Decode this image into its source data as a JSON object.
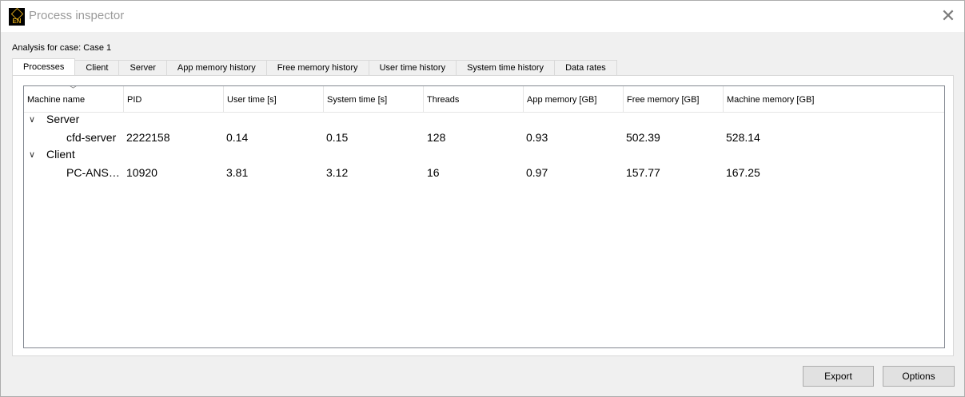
{
  "window": {
    "title": "Process inspector",
    "icon_text": "EN",
    "close_glyph": "✕"
  },
  "case_label": "Analysis for case: Case 1",
  "tabs": [
    {
      "label": "Processes",
      "active": true
    },
    {
      "label": "Client"
    },
    {
      "label": "Server"
    },
    {
      "label": "App memory history"
    },
    {
      "label": "Free memory history"
    },
    {
      "label": "User time history"
    },
    {
      "label": "System time history"
    },
    {
      "label": "Data rates"
    }
  ],
  "table": {
    "sort_glyph": "﹀",
    "columns": [
      "Machine name",
      "PID",
      "User time [s]",
      "System time [s]",
      "Threads",
      "App memory [GB]",
      "Free memory [GB]",
      "Machine memory [GB]"
    ],
    "groups": [
      {
        "name": "Server",
        "expander": "∨",
        "rows": [
          [
            "cfd-server",
            "2222158",
            "0.14",
            "0.15",
            "128",
            "0.93",
            "502.39",
            "528.14"
          ]
        ]
      },
      {
        "name": "Client",
        "expander": "∨",
        "rows": [
          [
            "PC-ANS…",
            "10920",
            "3.81",
            "3.12",
            "16",
            "0.97",
            "157.77",
            "167.25"
          ]
        ]
      }
    ]
  },
  "buttons": {
    "export": "Export",
    "options": "Options"
  }
}
